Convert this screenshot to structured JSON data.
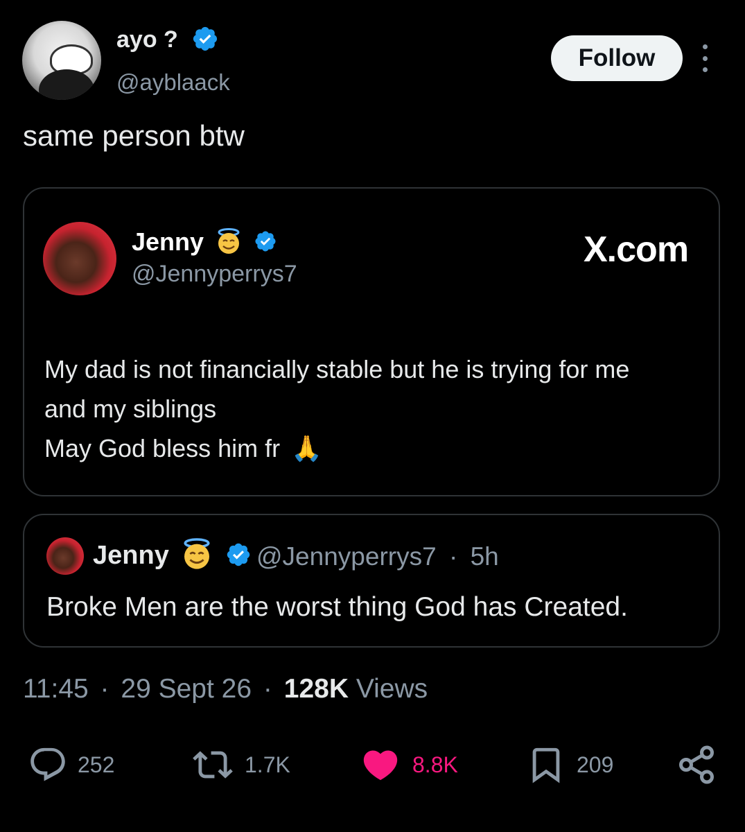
{
  "author": {
    "display_name": "ayo ?",
    "handle": "@ayblaack",
    "follow_label": "Follow"
  },
  "tweet": {
    "text": "same person btw"
  },
  "embedded_card": {
    "display_name": "Jenny",
    "handle": "@Jennyperrys7",
    "brand": "X.com",
    "lines": [
      "My dad is not financially stable but he is trying for me",
      "and my siblings",
      "May God bless him fr"
    ],
    "emoji": "🙏"
  },
  "quoted_tweet": {
    "display_name": "Jenny",
    "handle": "@Jennyperrys7",
    "separator": "·",
    "age": "5h",
    "text": "Broke Men are the worst thing God has Created."
  },
  "meta": {
    "time": "11:45",
    "sep1": "·",
    "date": "29 Sept 26",
    "sep2": "·",
    "views_count": "128K",
    "views_label": "Views"
  },
  "actions": {
    "replies": "252",
    "reposts": "1.7K",
    "likes": "8.8K",
    "bookmarks": "209"
  },
  "colors": {
    "background": "#000000",
    "verified": "#1d9bf0",
    "like": "#f91880",
    "muted": "#8b98a5"
  }
}
